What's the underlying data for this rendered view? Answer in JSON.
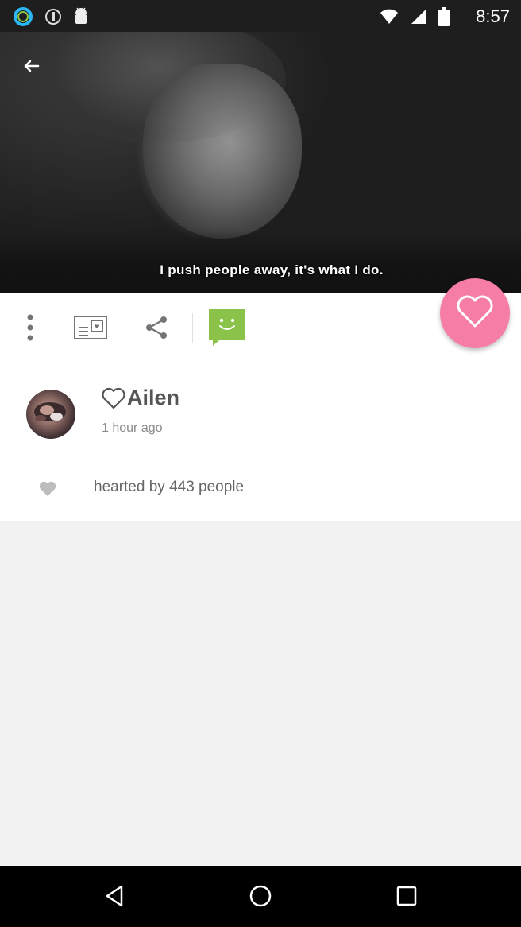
{
  "status_bar": {
    "time": "8:57",
    "icons": [
      "notification-ring-icon",
      "notification-circle-icon",
      "android-icon",
      "wifi-icon",
      "signal-icon",
      "battery-icon"
    ]
  },
  "hero": {
    "caption": "I push people away, it's what I do."
  },
  "toolbar": {
    "icons": [
      "more-vert-icon",
      "card-icon",
      "share-icon",
      "chat-icon"
    ]
  },
  "post": {
    "author": "Ailen",
    "timestamp": "1 hour ago",
    "hearted_text": "hearted by 443 people"
  },
  "colors": {
    "accent_pink": "#f67ea6",
    "chat_green": "#8bc34a"
  }
}
